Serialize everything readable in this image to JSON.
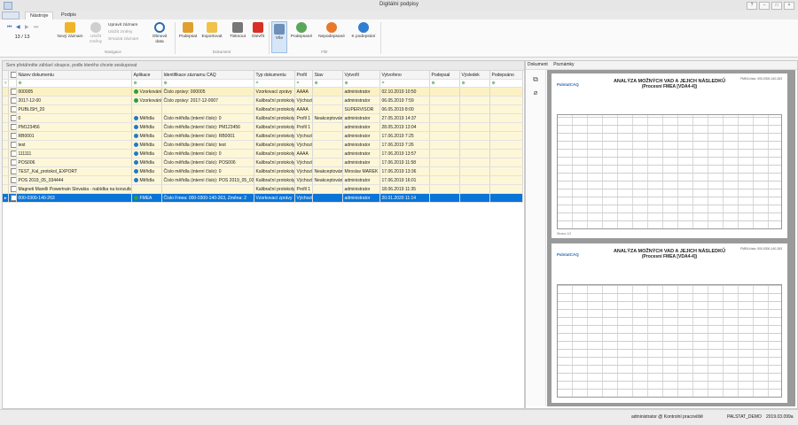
{
  "window": {
    "title": "Digitální podpisy"
  },
  "tabs": {
    "file": "",
    "active": "Nástroje",
    "second": "Podpis"
  },
  "navigation": {
    "counter": "13 / 13",
    "group": "Navigace"
  },
  "ribbon": {
    "new_record": "Nový záznam",
    "approve": "Uložit změny",
    "edit_record": "Upravit záznam",
    "save_changes": "Uložit změny",
    "delete_record": "Smazat záznam",
    "refresh": "Obnovit data",
    "document_group": "Dokument",
    "sign": "Podepsat",
    "export": "Exportovat",
    "print": "Tisknout",
    "open": "Otevřít",
    "all": "Vše",
    "signed": "Podepsané",
    "unsigned": "Nepodepsané",
    "to_sign": "K podepsání",
    "filter_group": "Filtr"
  },
  "grid": {
    "group_hint": "Sem přetáhněte záhlaví sloupce, podle kterého chcete seskupovat",
    "columns": [
      "Název dokumentu",
      "Aplikace",
      "Identifikace záznamu CAQ",
      "Typ dokumentu",
      "Profil",
      "Stav",
      "Vytvořil",
      "Vytvořeno",
      "Podepsal",
      "Výsledek",
      "Podepsáno"
    ],
    "filter_eq": "=",
    "rows": [
      {
        "name": "000005",
        "app": "Vzorkování",
        "app_color": "#2e9e3e",
        "id": "Číslo zprávy: 000005",
        "type": "Vzorkovací zprávy",
        "profile": "AAAA",
        "state": "",
        "creator": "administrator",
        "created": "02.10.2019 10:50"
      },
      {
        "name": "2017-12-00",
        "app": "Vzorkování",
        "app_color": "#2e9e3e",
        "id": "Číslo zprávy: 2017-12-0007",
        "type": "Kalibrační protokoly",
        "profile": "Výchozí",
        "state": "",
        "creator": "administrator",
        "created": "06.05.2019 7:59"
      },
      {
        "name": "PUBLISH_20",
        "app": "",
        "app_color": "",
        "id": "",
        "type": "Kalibrační protokoly",
        "profile": "AAAA",
        "state": "",
        "creator": "SUPERVISOR",
        "created": "06.05.2019 8:00"
      },
      {
        "name": "0",
        "app": "Měřidla",
        "app_color": "#1f7ac8",
        "id": "Číslo měřidla (interní číslo): 0",
        "type": "Kalibrační protokoly",
        "profile": "Profil 1",
        "state": "Neakceptováno",
        "creator": "administrator",
        "created": "27.05.2019 14:37"
      },
      {
        "name": "PM123456",
        "app": "Měřidla",
        "app_color": "#1f7ac8",
        "id": "Číslo měřidla (interní číslo): PM123456",
        "type": "Kalibrační protokoly",
        "profile": "Profil 1",
        "state": "",
        "creator": "administrator",
        "created": "28.05.2019 13:04"
      },
      {
        "name": "RB0001",
        "app": "Měřidla",
        "app_color": "#1f7ac8",
        "id": "Číslo měřidla (interní číslo): RB0001",
        "type": "Kalibrační protokoly",
        "profile": "Výchozí",
        "state": "",
        "creator": "administrator",
        "created": "17.06.2019 7:25"
      },
      {
        "name": "test",
        "app": "Měřidla",
        "app_color": "#1f7ac8",
        "id": "Číslo měřidla (interní číslo): test",
        "type": "Kalibrační protokoly",
        "profile": "Výchozí",
        "state": "",
        "creator": "administrator",
        "created": "17.06.2019 7:26"
      },
      {
        "name": "111111",
        "app": "Měřidla",
        "app_color": "#1f7ac8",
        "id": "Číslo měřidla (interní číslo): 0",
        "type": "Kalibrační protokoly",
        "profile": "AAAA",
        "state": "",
        "creator": "administrator",
        "created": "17.06.2019 13:57"
      },
      {
        "name": "POS006",
        "app": "Měřidla",
        "app_color": "#1f7ac8",
        "id": "Číslo měřidla (interní číslo): POS006",
        "type": "Kalibrační protokoly",
        "profile": "Výchozí",
        "state": "",
        "creator": "administrator",
        "created": "17.06.2019 11:58"
      },
      {
        "name": "TEST_Kal_protokol_EXPORT",
        "app": "Měřidla",
        "app_color": "#1f7ac8",
        "id": "Číslo měřidla (interní číslo): 0",
        "type": "Kalibrační protokoly",
        "profile": "Výchozí",
        "state": "Neakceptováno",
        "creator": "Miroslav MAREK",
        "created": "17.06.2019 13:36"
      },
      {
        "name": "POS 2019_05_034444",
        "app": "Měřidla",
        "app_color": "#1f7ac8",
        "id": "Číslo měřidla (interní číslo): POS 2019_05_03",
        "type": "Kalibrační protokoly",
        "profile": "Výchozí",
        "state": "Neakceptováno",
        "creator": "administrator",
        "created": "17.06.2019 16:01"
      },
      {
        "name": "Magneti Marelli Powertrain Slovakia - nabídka na konzultaci",
        "app": "",
        "app_color": "",
        "id": "",
        "type": "Kalibrační protokoly",
        "profile": "Profil 1",
        "state": "",
        "creator": "administrator",
        "created": "18.06.2019 11:35"
      },
      {
        "name": "000-0300-140-263",
        "app": "FMEA",
        "app_color": "#2e9e3e",
        "id": "Číslo Fmea: 000-0300-140-263, Změna: 2",
        "type": "Vzorkovací zprávy",
        "profile": "Výchozí",
        "state": "",
        "creator": "administrator",
        "created": "20.01.2020 11:14"
      }
    ]
  },
  "preview": {
    "tabs": [
      "Dokument",
      "Poznámky"
    ],
    "title": "ANALÝZA MOŽNÝCH VAD A JEJICH NÁSLEDKŮ",
    "subtitle": "(Procesní FMEA [VDA4-4])",
    "logo": "PalstatCAQ",
    "fmea_no": "FMEA číslo: 000-0300-140-263",
    "footer": "Strana 1/2"
  },
  "status": {
    "user": "administrator @ Kontrolní pracoviště",
    "db": "PALSTAT_DEMO",
    "version": "2019.03.099a"
  }
}
